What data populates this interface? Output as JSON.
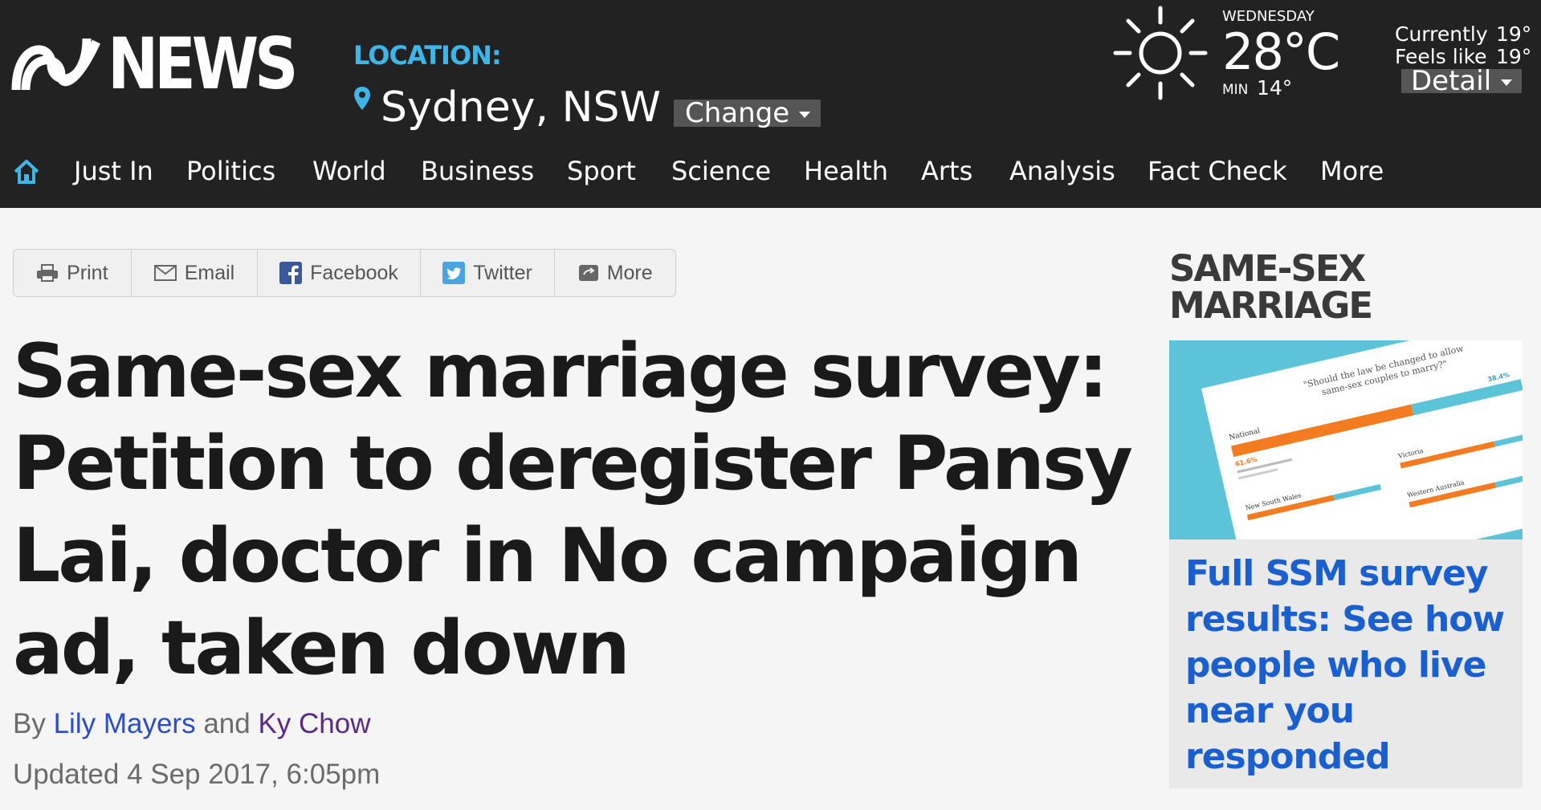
{
  "header": {
    "logo_text": "NEWS",
    "location_label": "LOCATION:",
    "location_city": "Sydney, NSW",
    "change_label": "Change",
    "weather": {
      "day": "WEDNESDAY",
      "temp": "28°C",
      "min_label": "MIN",
      "min_value": "14°",
      "currently_label": "Currently",
      "currently_value": "19°",
      "feels_label": "Feels like",
      "feels_value": "19°",
      "detail_label": "Detail"
    }
  },
  "nav": {
    "items": [
      "Just In",
      "Politics",
      "World",
      "Business",
      "Sport",
      "Science",
      "Health",
      "Arts",
      "Analysis",
      "Fact Check",
      "More"
    ]
  },
  "share": {
    "print": "Print",
    "email": "Email",
    "facebook": "Facebook",
    "twitter": "Twitter",
    "more": "More"
  },
  "article": {
    "headline": "Same-sex marriage survey: Petition to deregister Pansy Lai, doctor in No campaign ad, taken down",
    "by": "By",
    "author1": "Lily Mayers",
    "and": "and",
    "author2": "Ky Chow",
    "updated_label": "Updated",
    "updated_value": "4 Sep 2017, 6:05pm"
  },
  "sidebar": {
    "title": "SAME-SEX MARRIAGE",
    "image_caption_lines": [
      "\"Should the law be changed to allow",
      "same-sex couples to marry?\""
    ],
    "image_labels": {
      "national": "National",
      "nsw": "New South Wales",
      "victoria": "Victoria",
      "wa": "Western Australia",
      "pct_yes": "61.6%",
      "pct_no": "38.4%"
    },
    "link_text": "Full SSM survey results: See how people who live near you responded"
  },
  "colors": {
    "header_bg": "#222222",
    "accent_blue": "#3fb6e8",
    "link_blue": "#1a5fd0",
    "bar_orange": "#f47b20",
    "bar_cyan": "#5cc3d8"
  }
}
